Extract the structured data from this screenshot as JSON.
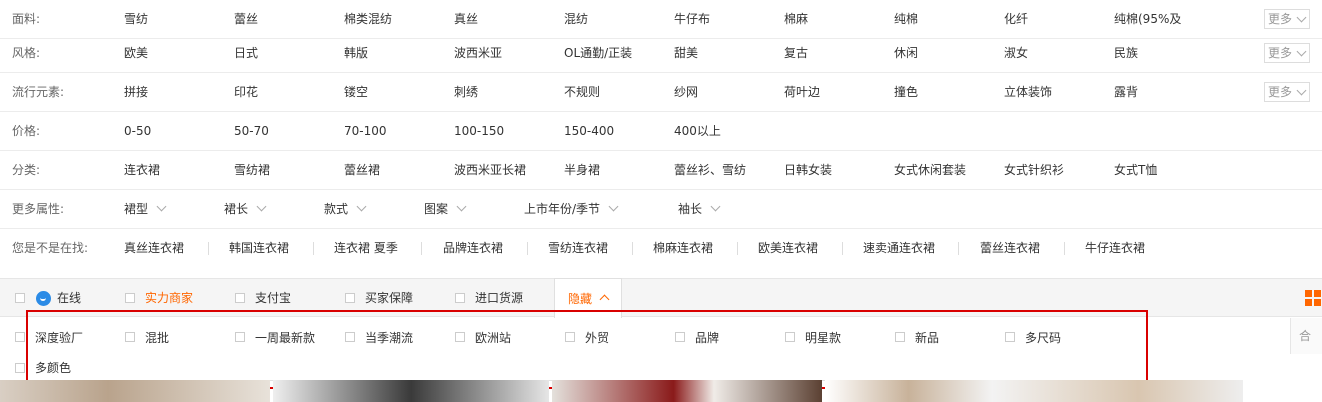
{
  "rows": [
    {
      "label": "面料:",
      "options": [
        "雪纺",
        "蕾丝",
        "棉类混纺",
        "真丝",
        "混纺",
        "牛仔布",
        "棉麻",
        "纯棉",
        "化纤",
        "纯棉(95%及"
      ],
      "more": "更多"
    },
    {
      "label": "风格:",
      "options": [
        "欧美",
        "日式",
        "韩版",
        "波西米亚",
        "OL通勤/正装",
        "甜美",
        "复古",
        "休闲",
        "淑女",
        "民族"
      ],
      "more": "更多"
    },
    {
      "label": "流行元素:",
      "options": [
        "拼接",
        "印花",
        "镂空",
        "刺绣",
        "不规则",
        "纱网",
        "荷叶边",
        "撞色",
        "立体装饰",
        "露背"
      ],
      "more": "更多"
    },
    {
      "label": "价格:",
      "options": [
        "0-50",
        "50-70",
        "70-100",
        "100-150",
        "150-400",
        "400以上"
      ]
    },
    {
      "label": "分类:",
      "options": [
        "连衣裙",
        "雪纺裙",
        "蕾丝裙",
        "波西米亚长裙",
        "半身裙",
        "蕾丝衫、雪纺",
        "日韩女装",
        "女式休闲套装",
        "女式针织衫",
        "女式T恤"
      ]
    }
  ],
  "attributes": {
    "label": "更多属性:",
    "dropdowns": [
      "裙型",
      "裙长",
      "款式",
      "图案",
      "上市年份/季节",
      "袖长"
    ]
  },
  "suggest": {
    "label": "您是不是在找:",
    "items": [
      "真丝连衣裙",
      "韩国连衣裙",
      "连衣裙 夏季",
      "品牌连衣裙",
      "雪纺连衣裙",
      "棉麻连衣裙",
      "欧美连衣裙",
      "速卖通连衣裙",
      "蕾丝连衣裙",
      "牛仔连衣裙"
    ]
  },
  "filter_bar": {
    "items": [
      "在线",
      "实力商家",
      "支付宝",
      "买家保障",
      "进口货源"
    ],
    "hide_toggle": "隐藏"
  },
  "hidden_panel": {
    "items": [
      "深度验厂",
      "混批",
      "一周最新款",
      "当季潮流",
      "欧洲站",
      "外贸",
      "品牌",
      "明星款",
      "新品",
      "多尺码",
      "多颜色"
    ]
  },
  "right_strip_text": "合并",
  "colors": {
    "accent": "#ff6600",
    "highlight_border": "#d90000",
    "online_icon": "#2b8be6"
  }
}
